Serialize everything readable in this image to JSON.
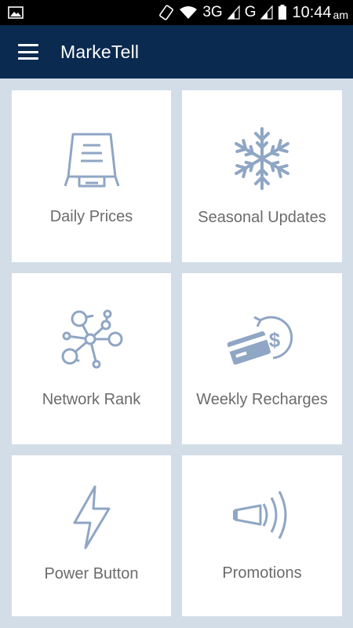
{
  "status_bar": {
    "network_label": "3G",
    "carrier_label": "G",
    "time": "10:44",
    "ampm": "am",
    "icons": [
      "image-notification-icon",
      "rotate-icon",
      "wifi-icon",
      "signal-icon",
      "signal-icon",
      "battery-icon"
    ]
  },
  "app_bar": {
    "menu_icon": "hamburger-menu-icon",
    "title": "MarkeTell"
  },
  "tiles": [
    {
      "label": "Daily Prices",
      "icon": "price-board-icon"
    },
    {
      "label": "Seasonal Updates",
      "icon": "snowflake-icon"
    },
    {
      "label": "Network Rank",
      "icon": "network-nodes-icon"
    },
    {
      "label": "Weekly Recharges",
      "icon": "card-recharge-icon"
    },
    {
      "label": "Power Button",
      "icon": "lightning-bolt-icon"
    },
    {
      "label": "Promotions",
      "icon": "megaphone-icon"
    }
  ],
  "colors": {
    "app_bar": "#0a2a4f",
    "background": "#d3dde8",
    "icon": "#8fa6c4",
    "label": "#6b6b6b"
  }
}
